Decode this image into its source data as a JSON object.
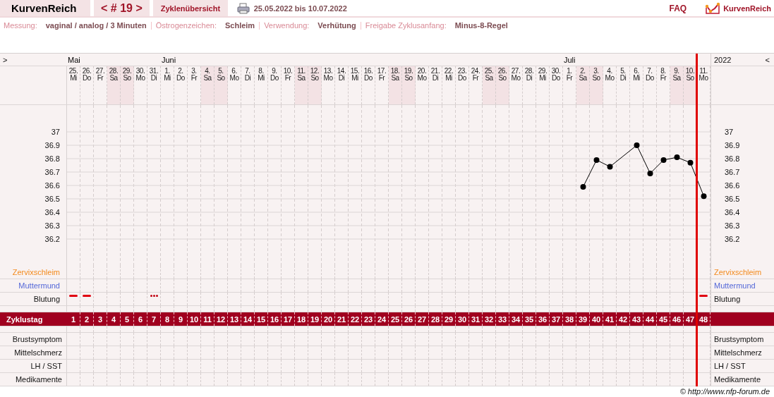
{
  "header": {
    "app_title": "KurvenReich",
    "cycle_nav": "< # 19 >",
    "overview_link": "Zyklenübersicht",
    "date_range": "25.05.2022 bis 10.07.2022",
    "faq": "FAQ",
    "logo_text": "KurvenReich"
  },
  "settings": [
    {
      "label": "Messung:",
      "value": "vaginal / analog / 3 Minuten"
    },
    {
      "label": "Östrogenzeichen:",
      "value": "Schleim"
    },
    {
      "label": "Verwendung:",
      "value": "Verhütung"
    },
    {
      "label": "Freigabe Zyklusanfang:",
      "value": "Minus-8-Regel"
    }
  ],
  "chart_nav": {
    "left": ">",
    "year": "2022",
    "right": "<"
  },
  "days": [
    {
      "date": "25.",
      "weekday": "Mi",
      "weekend": false,
      "cycle_day": "1",
      "month": "Mai",
      "bleeding": true
    },
    {
      "date": "26.",
      "weekday": "Do",
      "weekend": false,
      "cycle_day": "2",
      "bleeding": true
    },
    {
      "date": "27.",
      "weekday": "Fr",
      "weekend": false,
      "cycle_day": "3"
    },
    {
      "date": "28.",
      "weekday": "Sa",
      "weekend": true,
      "cycle_day": "4"
    },
    {
      "date": "29.",
      "weekday": "So",
      "weekend": true,
      "cycle_day": "5"
    },
    {
      "date": "30.",
      "weekday": "Mo",
      "weekend": false,
      "cycle_day": "6"
    },
    {
      "date": "31.",
      "weekday": "Di",
      "weekend": false,
      "cycle_day": "7",
      "spotting": true
    },
    {
      "date": "1.",
      "weekday": "Mi",
      "weekend": false,
      "cycle_day": "8",
      "month": "Juni"
    },
    {
      "date": "2.",
      "weekday": "Do",
      "weekend": false,
      "cycle_day": "9"
    },
    {
      "date": "3.",
      "weekday": "Fr",
      "weekend": false,
      "cycle_day": "10"
    },
    {
      "date": "4.",
      "weekday": "Sa",
      "weekend": true,
      "cycle_day": "11"
    },
    {
      "date": "5.",
      "weekday": "So",
      "weekend": true,
      "cycle_day": "12"
    },
    {
      "date": "6.",
      "weekday": "Mo",
      "weekend": false,
      "cycle_day": "13"
    },
    {
      "date": "7.",
      "weekday": "Di",
      "weekend": false,
      "cycle_day": "14"
    },
    {
      "date": "8.",
      "weekday": "Mi",
      "weekend": false,
      "cycle_day": "15"
    },
    {
      "date": "9.",
      "weekday": "Do",
      "weekend": false,
      "cycle_day": "16"
    },
    {
      "date": "10.",
      "weekday": "Fr",
      "weekend": false,
      "cycle_day": "17"
    },
    {
      "date": "11.",
      "weekday": "Sa",
      "weekend": true,
      "cycle_day": "18"
    },
    {
      "date": "12.",
      "weekday": "So",
      "weekend": true,
      "cycle_day": "19"
    },
    {
      "date": "13.",
      "weekday": "Mo",
      "weekend": false,
      "cycle_day": "20"
    },
    {
      "date": "14.",
      "weekday": "Di",
      "weekend": false,
      "cycle_day": "21"
    },
    {
      "date": "15.",
      "weekday": "Mi",
      "weekend": false,
      "cycle_day": "22"
    },
    {
      "date": "16.",
      "weekday": "Do",
      "weekend": false,
      "cycle_day": "23"
    },
    {
      "date": "17.",
      "weekday": "Fr",
      "weekend": false,
      "cycle_day": "24"
    },
    {
      "date": "18.",
      "weekday": "Sa",
      "weekend": true,
      "cycle_day": "25"
    },
    {
      "date": "19.",
      "weekday": "So",
      "weekend": true,
      "cycle_day": "26"
    },
    {
      "date": "20.",
      "weekday": "Mo",
      "weekend": false,
      "cycle_day": "27"
    },
    {
      "date": "21.",
      "weekday": "Di",
      "weekend": false,
      "cycle_day": "28"
    },
    {
      "date": "22.",
      "weekday": "Mi",
      "weekend": false,
      "cycle_day": "29"
    },
    {
      "date": "23.",
      "weekday": "Do",
      "weekend": false,
      "cycle_day": "30"
    },
    {
      "date": "24.",
      "weekday": "Fr",
      "weekend": false,
      "cycle_day": "31"
    },
    {
      "date": "25.",
      "weekday": "Sa",
      "weekend": true,
      "cycle_day": "32"
    },
    {
      "date": "26.",
      "weekday": "So",
      "weekend": true,
      "cycle_day": "33"
    },
    {
      "date": "27.",
      "weekday": "Mo",
      "weekend": false,
      "cycle_day": "34"
    },
    {
      "date": "28.",
      "weekday": "Di",
      "weekend": false,
      "cycle_day": "35"
    },
    {
      "date": "29.",
      "weekday": "Mi",
      "weekend": false,
      "cycle_day": "36"
    },
    {
      "date": "30.",
      "weekday": "Do",
      "weekend": false,
      "cycle_day": "37"
    },
    {
      "date": "1.",
      "weekday": "Fr",
      "weekend": false,
      "cycle_day": "38",
      "month": "Juli"
    },
    {
      "date": "2.",
      "weekday": "Sa",
      "weekend": true,
      "cycle_day": "39"
    },
    {
      "date": "3.",
      "weekday": "So",
      "weekend": true,
      "cycle_day": "40"
    },
    {
      "date": "4.",
      "weekday": "Mo",
      "weekend": false,
      "cycle_day": "41"
    },
    {
      "date": "5.",
      "weekday": "Di",
      "weekend": false,
      "cycle_day": "42"
    },
    {
      "date": "6.",
      "weekday": "Mi",
      "weekend": false,
      "cycle_day": "43"
    },
    {
      "date": "7.",
      "weekday": "Do",
      "weekend": false,
      "cycle_day": "44"
    },
    {
      "date": "8.",
      "weekday": "Fr",
      "weekend": false,
      "cycle_day": "45"
    },
    {
      "date": "9.",
      "weekday": "Sa",
      "weekend": true,
      "cycle_day": "46"
    },
    {
      "date": "10.",
      "weekday": "So",
      "weekend": true,
      "cycle_day": "47"
    },
    {
      "date": "11.",
      "weekday": "Mo",
      "weekend": false,
      "cycle_day": "48",
      "bleeding": true,
      "divider_before": true
    }
  ],
  "temperature_chart": {
    "right_axis_labels": [
      "37",
      "36.9",
      "36.8",
      "36.7",
      "36.6",
      "36.5",
      "36.4",
      "36.3",
      "36.2"
    ],
    "chart_data": {
      "type": "line",
      "ylim": [
        36.0,
        37.5
      ],
      "grid": true,
      "yticks": [
        36.2,
        36.3,
        36.4,
        36.5,
        36.6,
        36.7,
        36.8,
        36.9,
        37
      ],
      "series": [
        {
          "color": "#000000",
          "marker": "circle",
          "values": [
            null,
            null,
            null,
            null,
            null,
            null,
            null,
            null,
            null,
            null,
            null,
            null,
            null,
            null,
            null,
            null,
            null,
            null,
            null,
            null,
            null,
            null,
            null,
            null,
            null,
            null,
            null,
            null,
            null,
            null,
            null,
            null,
            null,
            null,
            null,
            null,
            null,
            null,
            36.59,
            36.79,
            36.74,
            null,
            36.9,
            36.69,
            36.79,
            36.81,
            36.77,
            36.52
          ]
        }
      ]
    }
  },
  "observation_rows": [
    {
      "label": "Zervixschleim",
      "label_right": "Zervixschleim",
      "kind": "mucus"
    },
    {
      "label": "Muttermund",
      "label_right": "Muttermund",
      "kind": "cervix"
    },
    {
      "label": "Blutung",
      "label_right": "Blutung",
      "kind": "bleeding"
    }
  ],
  "cycle_day_label": "Zyklustag",
  "symptom_rows": [
    {
      "label": "Brustsymptom",
      "label_right": "Brustsymptom"
    },
    {
      "label": "Mittelschmerz",
      "label_right": "Mittelschmerz"
    },
    {
      "label": "LH / SST",
      "label_right": "LH / SST"
    },
    {
      "label": "Medikamente",
      "label_right": "Medikamente"
    }
  ],
  "footer": "© http://www.nfp-forum.de"
}
